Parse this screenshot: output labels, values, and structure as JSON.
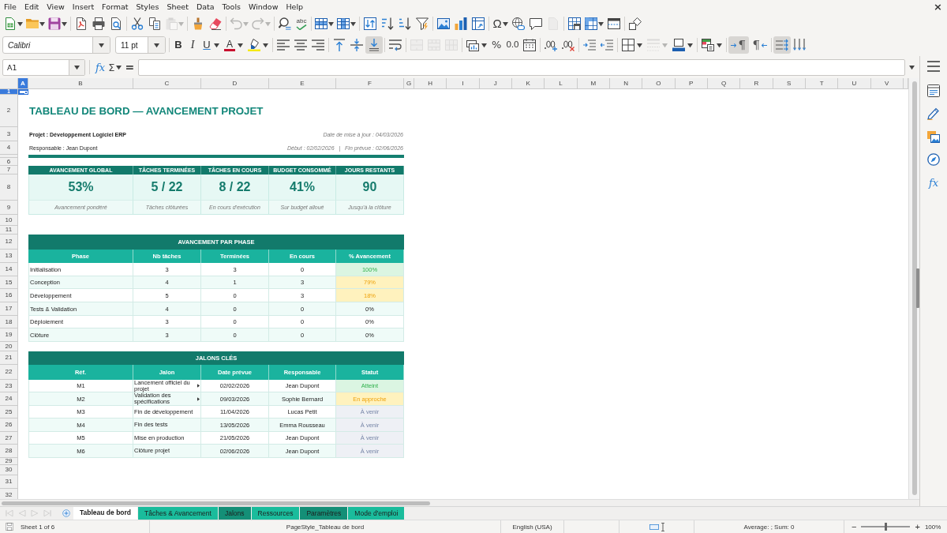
{
  "window": {
    "close": "×"
  },
  "menu_bar": [
    "File",
    "Edit",
    "View",
    "Insert",
    "Format",
    "Styles",
    "Sheet",
    "Data",
    "Tools",
    "Window",
    "Help"
  ],
  "standard_toolbar": {
    "paste": {
      "disabled": true
    },
    "undo": {
      "disabled": true
    },
    "redo": {
      "disabled": true
    },
    "spelling": "abc",
    "special_character": "Ω",
    "header_footer": {
      "disabled": true
    }
  },
  "formatting_toolbar": {
    "font_name": "Calibri",
    "font_size": "11 pt",
    "bold": "B",
    "italic": "I",
    "underline": "U",
    "font_color": "A",
    "vertical_align": [
      {
        "selected": false
      },
      {
        "selected": false
      },
      {
        "selected": true
      }
    ],
    "merge_cells": [
      {
        "disabled": true
      },
      {
        "disabled": true
      },
      {
        "disabled": true
      }
    ],
    "percent": "%",
    "number_format": "0.0",
    "border_style": {
      "disabled": true
    },
    "text_direction": [
      {
        "label": "¶",
        "selected": true
      },
      {
        "label": "¶",
        "selected": false
      }
    ],
    "wrap_text": {
      "on": true
    }
  },
  "formula_bar": {
    "name_box": "A1",
    "function_wizard": "fx",
    "sum": "Σ",
    "equals": "="
  },
  "sidebar": {
    "functions": "fx"
  },
  "sheet": {
    "column_headers": [
      {
        "label": "A",
        "selected": true
      },
      {
        "label": "B",
        "selected": false
      },
      {
        "label": "C",
        "selected": false
      },
      {
        "label": "D",
        "selected": false
      },
      {
        "label": "E",
        "selected": false
      },
      {
        "label": "F",
        "selected": false
      },
      {
        "label": "G",
        "selected": false
      },
      {
        "label": "H",
        "selected": false
      },
      {
        "label": "I",
        "selected": false
      },
      {
        "label": "J",
        "selected": false
      },
      {
        "label": "K",
        "selected": false
      },
      {
        "label": "L",
        "selected": false
      },
      {
        "label": "M",
        "selected": false
      },
      {
        "label": "N",
        "selected": false
      },
      {
        "label": "O",
        "selected": false
      },
      {
        "label": "P",
        "selected": false
      },
      {
        "label": "Q",
        "selected": false
      },
      {
        "label": "R",
        "selected": false
      },
      {
        "label": "S",
        "selected": false
      },
      {
        "label": "T",
        "selected": false
      },
      {
        "label": "U",
        "selected": false
      },
      {
        "label": "V",
        "selected": false
      }
    ],
    "row_headers": [
      {
        "label": "1",
        "selected": true
      },
      {
        "label": "2",
        "selected": false
      },
      {
        "label": "3",
        "selected": false
      },
      {
        "label": "4",
        "selected": false
      },
      {
        "label": "6",
        "selected": false
      },
      {
        "label": "7",
        "selected": false
      },
      {
        "label": "8",
        "selected": false
      },
      {
        "label": "9",
        "selected": false
      },
      {
        "label": "10",
        "selected": false
      },
      {
        "label": "11",
        "selected": false
      },
      {
        "label": "12",
        "selected": false
      },
      {
        "label": "13",
        "selected": false
      },
      {
        "label": "14",
        "selected": false
      },
      {
        "label": "15",
        "selected": false
      },
      {
        "label": "16",
        "selected": false
      },
      {
        "label": "17",
        "selected": false
      },
      {
        "label": "18",
        "selected": false
      },
      {
        "label": "19",
        "selected": false
      },
      {
        "label": "20",
        "selected": false
      },
      {
        "label": "21",
        "selected": false
      },
      {
        "label": "22",
        "selected": false
      },
      {
        "label": "23",
        "selected": false
      },
      {
        "label": "24",
        "selected": false
      },
      {
        "label": "25",
        "selected": false
      },
      {
        "label": "26",
        "selected": false
      },
      {
        "label": "27",
        "selected": false
      },
      {
        "label": "28",
        "selected": false
      },
      {
        "label": "29",
        "selected": false
      },
      {
        "label": "30",
        "selected": false
      },
      {
        "label": "31",
        "selected": false
      },
      {
        "label": "32",
        "selected": false
      }
    ],
    "title": "TABLEAU DE BORD — AVANCEMENT PROJET",
    "project": "Projet : Développement Logiciel ERP",
    "updated": "Date de mise à jour : 04/03/2026",
    "manager": "Responsable : Jean Dupont",
    "dates": "Début : 02/02/2026   |   Fin prévue : 02/06/2026",
    "kpis": [
      {
        "label": "AVANCEMENT GLOBAL",
        "value": "53%",
        "caption": "Avancement pondéré"
      },
      {
        "label": "TÂCHES TERMINÉES",
        "value": "5 / 22",
        "caption": "Tâches clôturées"
      },
      {
        "label": "TÂCHES EN COURS",
        "value": "8 / 22",
        "caption": "En cours d'exécution"
      },
      {
        "label": "BUDGET CONSOMMÉ",
        "value": "41%",
        "caption": "Sur budget alloué"
      },
      {
        "label": "JOURS RESTANTS",
        "value": "90",
        "caption": "Jusqu'à la clôture"
      }
    ],
    "phase_table": {
      "title": "AVANCEMENT PAR PHASE",
      "columns": [
        "Phase",
        "Nb tâches",
        "Terminées",
        "En cours",
        "% Avancement"
      ],
      "rows": [
        {
          "cells": [
            "Initialisation",
            "3",
            "3",
            "0",
            "100%"
          ],
          "kind": "complete"
        },
        {
          "cells": [
            "Conception",
            "4",
            "1",
            "3",
            "79%"
          ],
          "kind": "partial"
        },
        {
          "cells": [
            "Développement",
            "5",
            "0",
            "3",
            "18%"
          ],
          "kind": "partial"
        },
        {
          "cells": [
            "Tests & Validation",
            "4",
            "0",
            "0",
            "0%"
          ],
          "kind": "none"
        },
        {
          "cells": [
            "Déploiement",
            "3",
            "0",
            "0",
            "0%"
          ],
          "kind": "none"
        },
        {
          "cells": [
            "Clôture",
            "3",
            "0",
            "0",
            "0%"
          ],
          "kind": "none"
        }
      ]
    },
    "milestones_table": {
      "title": "JALONS CLÉS",
      "columns": [
        "Réf.",
        "Jalon",
        "Date prévue",
        "Responsable",
        "Statut"
      ],
      "rows": [
        {
          "cells": [
            "M1",
            "Lancement officiel du projet",
            "02/02/2026",
            "Jean Dupont",
            "Atteint"
          ],
          "kind": "reached",
          "clipped": true
        },
        {
          "cells": [
            "M2",
            "Validation des spécifications",
            "09/03/2026",
            "Sophie Bernard",
            "En approche"
          ],
          "kind": "approaching",
          "clipped": true
        },
        {
          "cells": [
            "M3",
            "Fin de développement",
            "11/04/2026",
            "Lucas Petit",
            "À venir"
          ],
          "kind": "upcoming",
          "clipped": false
        },
        {
          "cells": [
            "M4",
            "Fin des tests",
            "13/05/2026",
            "Emma Rousseau",
            "À venir"
          ],
          "kind": "upcoming",
          "clipped": false
        },
        {
          "cells": [
            "M5",
            "Mise en production",
            "21/05/2026",
            "Jean Dupont",
            "À venir"
          ],
          "kind": "upcoming",
          "clipped": false
        },
        {
          "cells": [
            "M6",
            "Clôture projet",
            "02/06/2026",
            "Jean Dupont",
            "À venir"
          ],
          "kind": "upcoming",
          "clipped": false
        }
      ]
    }
  },
  "sheet_tabs": {
    "scroll_buttons": [
      {
        "disabled": true
      },
      {
        "disabled": true
      },
      {
        "disabled": true
      },
      {
        "disabled": true
      }
    ],
    "tabs": [
      {
        "label": "Tableau de bord",
        "selected": true
      },
      {
        "label": "Tâches & Avancement",
        "selected": false,
        "color": "#1abc9c"
      },
      {
        "label": "Jalons",
        "selected": false,
        "color": "#148f77"
      },
      {
        "label": "Ressources",
        "selected": false,
        "color": "#1abc9c"
      },
      {
        "label": "Paramètres",
        "selected": false,
        "color": "#148f77"
      },
      {
        "label": "Mode d'emploi",
        "selected": false,
        "color": "#1abc9c"
      }
    ]
  },
  "status_bar": {
    "sheet_position": "Sheet 1 of 6",
    "page_style": "PageStyle_Tableau de bord",
    "language": "English (USA)",
    "summary": "Average: ; Sum: 0",
    "zoom": {
      "minus": "−",
      "plus": "+",
      "level": 0.5,
      "reading": "100%"
    }
  }
}
